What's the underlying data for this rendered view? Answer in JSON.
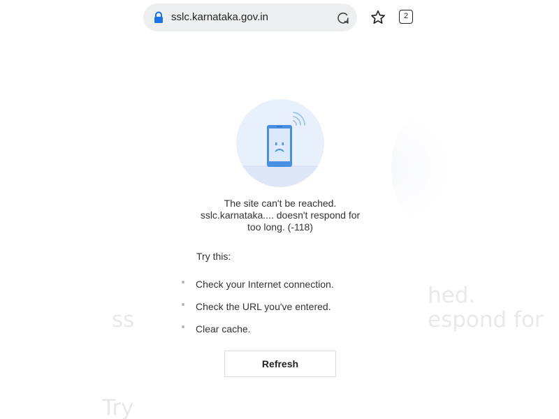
{
  "browser": {
    "url": "sslc.karnataka.gov.in",
    "tab_count": "2",
    "icons": {
      "lock": "lock-icon",
      "reload": "reload-icon",
      "bookmark": "star-icon",
      "tabs": "tabs-icon"
    }
  },
  "error": {
    "illustration": "sad-phone-wifi-icon",
    "line1": "The site can't be reached.",
    "line2": "sslc.karnataka.... doesn't respond for",
    "line3": "too long. (-118)",
    "try_this": "Try this:",
    "tips": [
      "Check your Internet connection.",
      "Check the URL you've entered.",
      "Clear cache."
    ],
    "refresh_label": "Refresh"
  },
  "ghost_text": {
    "t1": "hed.",
    "t2": "ss",
    "t3": "espond for",
    "t4": "Try"
  },
  "colors": {
    "accent": "#4a90e2",
    "lock": "#1a73e8",
    "illustration_bg": "#e8f0fc"
  }
}
